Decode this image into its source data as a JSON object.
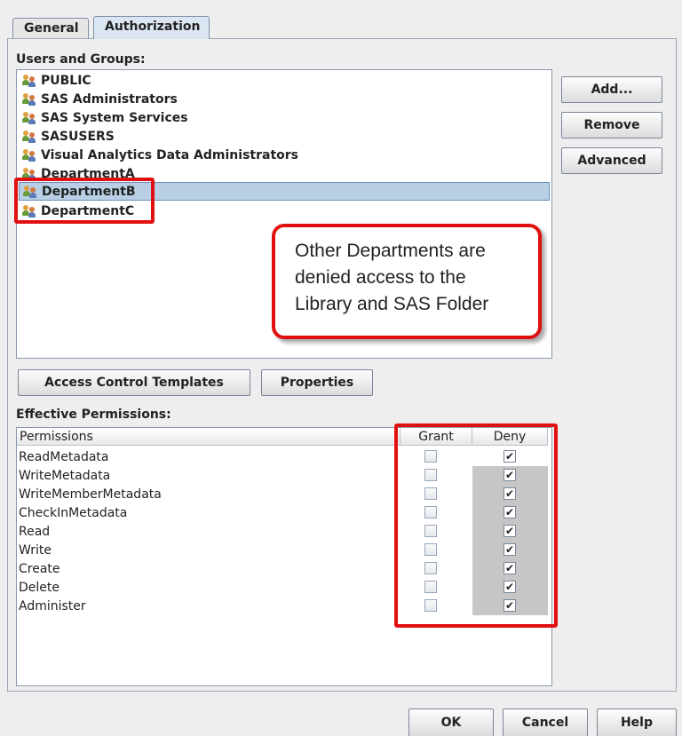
{
  "tabs": [
    {
      "label": "General",
      "active": false
    },
    {
      "label": "Authorization",
      "active": true
    }
  ],
  "users_groups": {
    "label": "Users and Groups:",
    "items": [
      {
        "name": "PUBLIC",
        "selected": false
      },
      {
        "name": "SAS Administrators",
        "selected": false
      },
      {
        "name": "SAS System Services",
        "selected": false
      },
      {
        "name": "SASUSERS",
        "selected": false
      },
      {
        "name": "Visual Analytics Data Administrators",
        "selected": false
      },
      {
        "name": "DepartmentA",
        "selected": false
      },
      {
        "name": "DepartmentB",
        "selected": true
      },
      {
        "name": "DepartmentC",
        "selected": false
      }
    ]
  },
  "side_buttons": {
    "add": "Add...",
    "remove": "Remove",
    "advanced": "Advanced"
  },
  "callout": {
    "line1": "Other Departments are",
    "line2": "denied access to the",
    "line3": "Library and SAS Folder"
  },
  "mid_buttons": {
    "act": "Access Control Templates",
    "properties": "Properties"
  },
  "effective": {
    "label": "Effective Permissions:",
    "columns": [
      "Permissions",
      "Grant",
      "Deny"
    ],
    "rows": [
      {
        "permission": "ReadMetadata",
        "grant": false,
        "deny": true,
        "deny_shaded": false
      },
      {
        "permission": "WriteMetadata",
        "grant": false,
        "deny": true,
        "deny_shaded": true
      },
      {
        "permission": "WriteMemberMetadata",
        "grant": false,
        "deny": true,
        "deny_shaded": true
      },
      {
        "permission": "CheckInMetadata",
        "grant": false,
        "deny": true,
        "deny_shaded": true
      },
      {
        "permission": "Read",
        "grant": false,
        "deny": true,
        "deny_shaded": true
      },
      {
        "permission": "Write",
        "grant": false,
        "deny": true,
        "deny_shaded": true
      },
      {
        "permission": "Create",
        "grant": false,
        "deny": true,
        "deny_shaded": true
      },
      {
        "permission": "Delete",
        "grant": false,
        "deny": true,
        "deny_shaded": true
      },
      {
        "permission": "Administer",
        "grant": false,
        "deny": true,
        "deny_shaded": true
      }
    ]
  },
  "footer_buttons": {
    "ok": "OK",
    "cancel": "Cancel",
    "help": "Help"
  },
  "colors": {
    "highlight": "#e01010",
    "selection": "#b8cfe5"
  }
}
